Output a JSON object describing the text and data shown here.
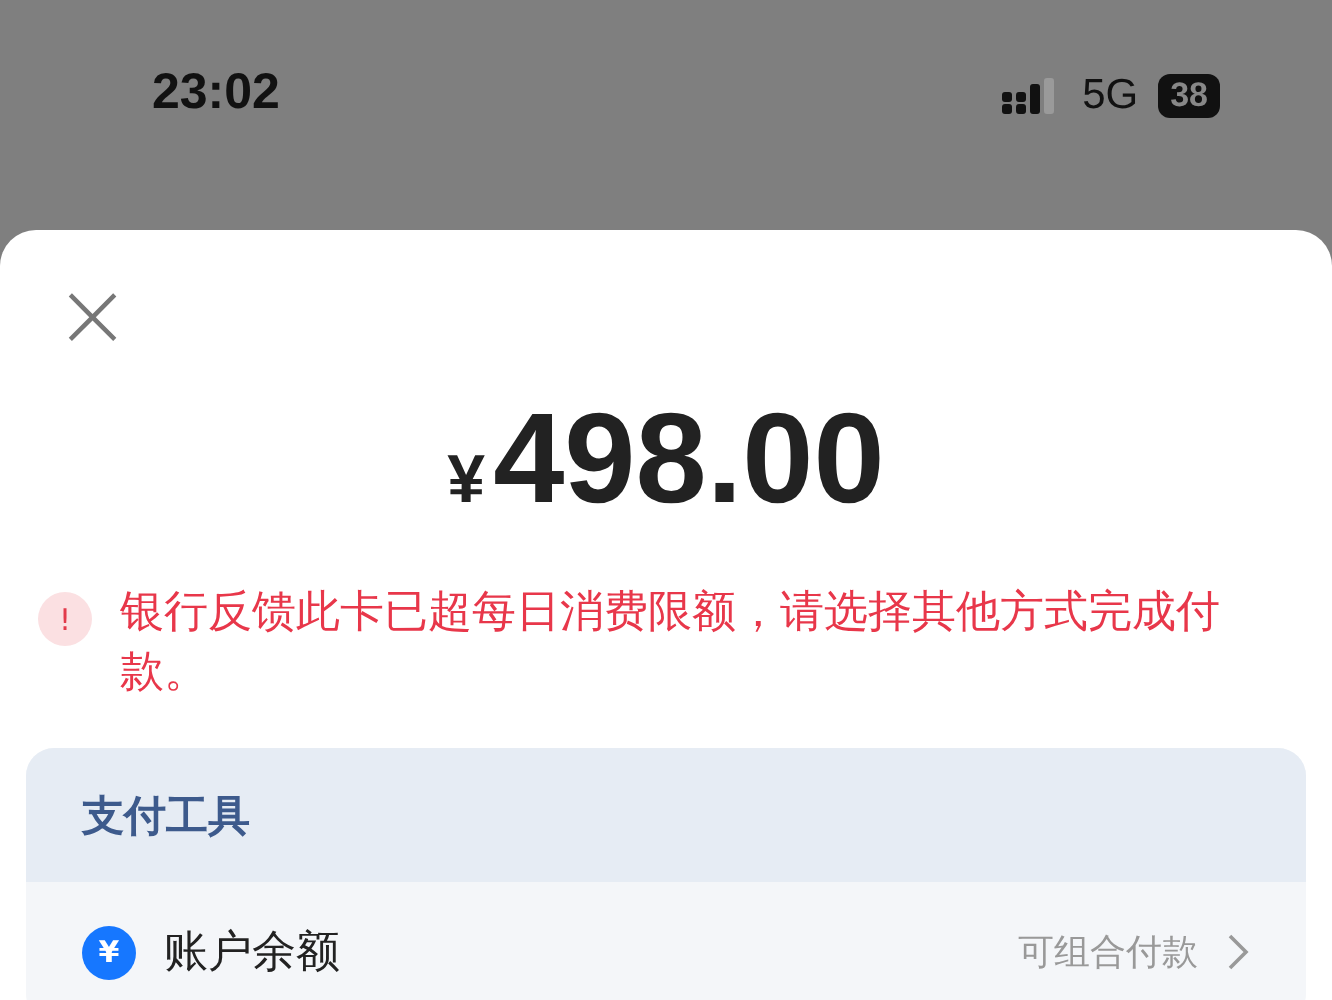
{
  "status_bar": {
    "time": "23:02",
    "network": "5G",
    "battery": "38"
  },
  "sheet": {
    "close": "×",
    "amount": {
      "currency": "¥",
      "value": "498.00"
    },
    "error": {
      "icon": "!",
      "message": "银行反馈此卡已超每日消费限额，请选择其他方式完成付款。"
    },
    "payment_tools": {
      "title": "支付工具",
      "items": [
        {
          "icon": "¥",
          "label": "账户余额",
          "note": "可组合付款"
        }
      ]
    }
  }
}
